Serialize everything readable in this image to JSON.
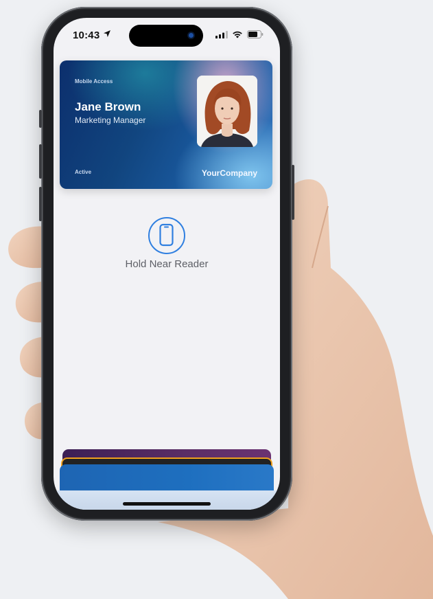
{
  "status_bar": {
    "time": "10:43"
  },
  "card": {
    "eyebrow": "Mobile Access",
    "name": "Jane Brown",
    "role": "Marketing Manager",
    "status": "Active",
    "company": "YourCompany"
  },
  "reader": {
    "label": "Hold Near Reader"
  },
  "colors": {
    "accent": "#2f7fe0",
    "card_start": "#0c2f6d",
    "card_end": "#3a7cc4",
    "background": "#eef0f3"
  },
  "icons": {
    "location": "location-arrow-icon",
    "signal": "cellular-signal-icon",
    "wifi": "wifi-icon",
    "battery": "battery-icon",
    "reader": "phone-nfc-icon"
  }
}
